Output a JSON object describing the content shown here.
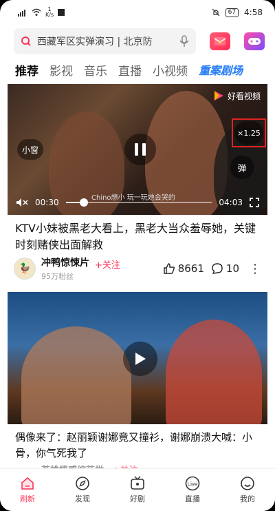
{
  "status_bar": {
    "net_rate_top": "1",
    "net_rate_bottom": "K/s",
    "battery": "67",
    "time": "4:58"
  },
  "search": {
    "query": "西藏军区实弹演习 | 北京防",
    "icons": [
      "search-icon",
      "mic-icon",
      "red-envelope-icon",
      "game-icon"
    ]
  },
  "tabs": [
    {
      "label": "推荐",
      "active": true
    },
    {
      "label": "影视"
    },
    {
      "label": "音乐"
    },
    {
      "label": "直播"
    },
    {
      "label": "小视频"
    },
    {
      "label": "重案剧场",
      "special": true
    }
  ],
  "video1": {
    "brand": "好看视频",
    "mini_window": "小窗",
    "speed": "×1.25",
    "danmaku": "弹",
    "caption": "Chino想小 玩一玩她会哭的",
    "current_time": "00:30",
    "duration": "04:03",
    "progress": 0.123,
    "title": "KTV小妹被黑老大看上，黑老大当众羞辱她，关键时刻赌侠出面解救",
    "author": "冲鸭惊悚片",
    "follow": "+关注",
    "fans": "95万粉丝",
    "likes": "8661",
    "comments": "10"
  },
  "video2": {
    "title": "偶像来了：赵丽颖谢娜竟又撞衫，谢娜崩溃大喊：小骨，你气死我了",
    "next_author_peek": "英雄情感综艺世",
    "next_follow_peek": "+关注"
  },
  "bottom_nav": [
    {
      "label": "刷新",
      "icon": "home-refresh-icon",
      "active": true
    },
    {
      "label": "发现",
      "icon": "compass-icon"
    },
    {
      "label": "好剧",
      "icon": "tv-icon"
    },
    {
      "label": "直播",
      "icon": "live-icon"
    },
    {
      "label": "我的",
      "icon": "smile-profile-icon"
    }
  ],
  "colors": {
    "accent": "#ff3355",
    "special_tab": "#2a7df5",
    "highlight_box": "#e32222"
  }
}
